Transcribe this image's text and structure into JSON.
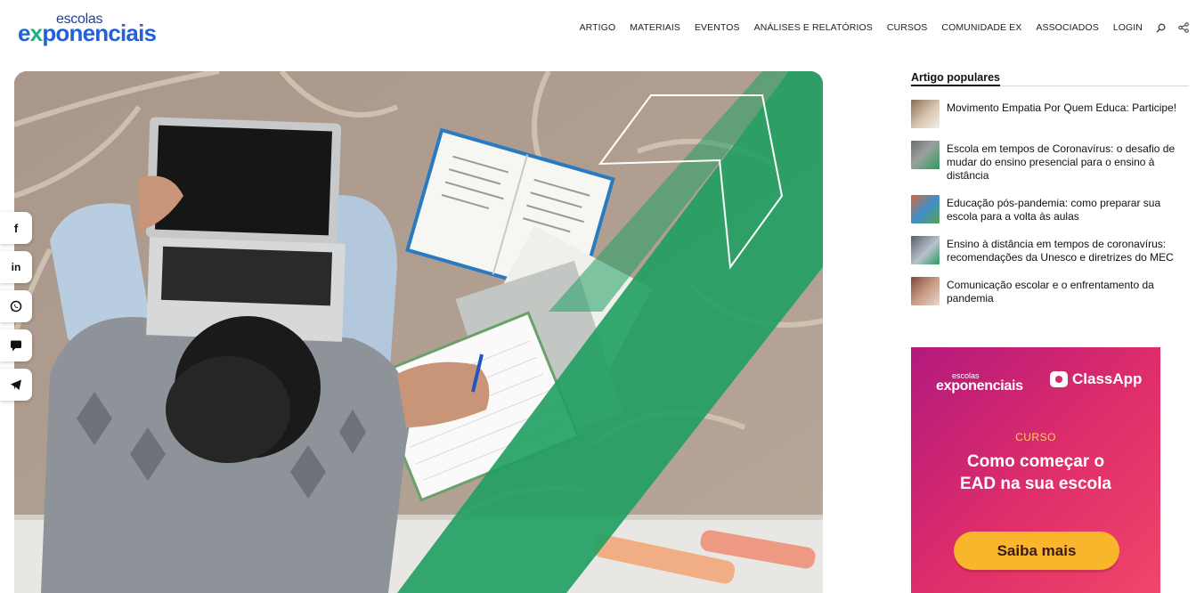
{
  "header": {
    "logo": {
      "small": "escolas",
      "big_prefix": "e",
      "big_x": "x",
      "big_rest": "ponenciais"
    },
    "nav": [
      {
        "label": "ARTIGO"
      },
      {
        "label": "MATERIAIS"
      },
      {
        "label": "EVENTOS"
      },
      {
        "label": "ANÁLISES E RELATÓRIOS"
      },
      {
        "label": "CURSOS"
      },
      {
        "label": "COMUNIDADE EX"
      },
      {
        "label": "ASSOCIADOS"
      },
      {
        "label": "LOGIN"
      }
    ],
    "icons": [
      "search-icon",
      "share-icon"
    ]
  },
  "social": {
    "buttons": [
      {
        "icon": "facebook-icon",
        "glyph": "f"
      },
      {
        "icon": "linkedin-icon",
        "glyph": "in"
      },
      {
        "icon": "whatsapp-icon",
        "glyph": ""
      },
      {
        "icon": "comment-icon",
        "glyph": ""
      },
      {
        "icon": "telegram-icon",
        "glyph": ""
      }
    ]
  },
  "sidebar": {
    "heading": "Artigo populares",
    "items": [
      {
        "title": "Movimento Empatia Por Quem Educa: Participe!"
      },
      {
        "title": "Escola em tempos de Coronavírus: o desafio de mudar do ensino presencial para o ensino à distância"
      },
      {
        "title": "Educação pós-pandemia: como preparar sua escola para a volta às aulas"
      },
      {
        "title": "Ensino à distância em tempos de coronavírus: recomendações da Unesco e diretrizes do MEC"
      },
      {
        "title": "Comunicação escolar e o enfrentamento da pandemia"
      }
    ]
  },
  "ad": {
    "logo_small": "escolas",
    "logo_big": "exponenciais",
    "partner": "ClassApp",
    "kicker": "CURSO",
    "title_line1": "Como começar o",
    "title_line2": "EAD na sua escola",
    "button": "Saiba mais"
  },
  "colors": {
    "brand_blue": "#2262d9",
    "brand_green": "#18b47b",
    "ad_magenta": "#b3197d",
    "ad_pink": "#f0466a",
    "ad_button": "#f9b62d"
  }
}
